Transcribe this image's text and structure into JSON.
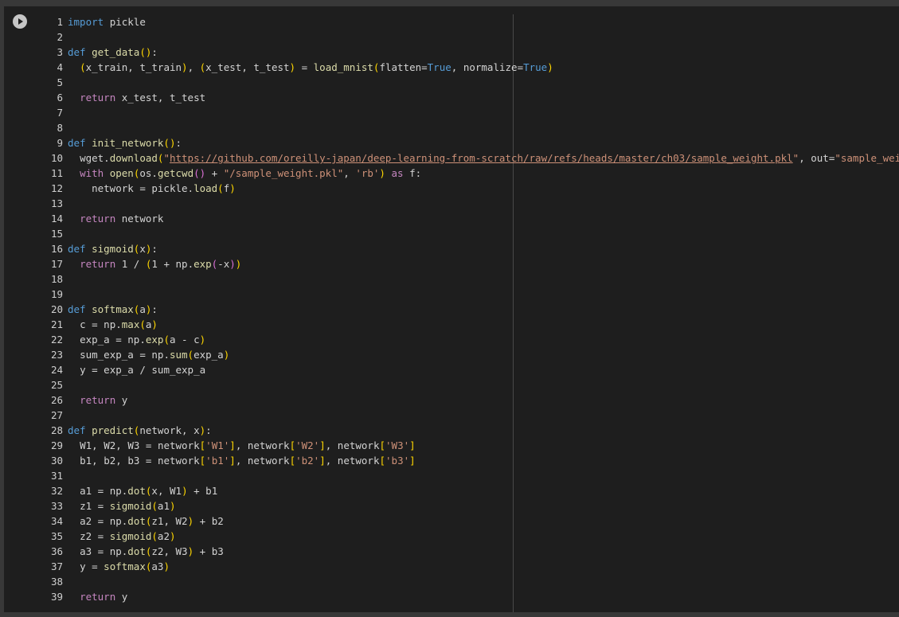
{
  "cell": {
    "run_button_icon": "play-circle-icon",
    "code_lines": [
      "import pickle",
      "",
      "def get_data():",
      "  (x_train, t_train), (x_test, t_test) = load_mnist(flatten=True, normalize=True)",
      "",
      "  return x_test, t_test",
      "",
      "",
      "def init_network():",
      "  wget.download(\"https://github.com/oreilly-japan/deep-learning-from-scratch/raw/refs/heads/master/ch03/sample_weight.pkl\", out=\"sample_weight.pkl\")",
      "  with open(os.getcwd() + \"/sample_weight.pkl\", 'rb') as f:",
      "    network = pickle.load(f)",
      "",
      "  return network",
      "",
      "def sigmoid(x):",
      "  return 1 / (1 + np.exp(-x))",
      "",
      "",
      "def softmax(a):",
      "  c = np.max(a)",
      "  exp_a = np.exp(a - c)",
      "  sum_exp_a = np.sum(exp_a)",
      "  y = exp_a / sum_exp_a",
      "",
      "  return y",
      "",
      "def predict(network, x):",
      "  W1, W2, W3 = network['W1'], network['W2'], network['W3']",
      "  b1, b2, b3 = network['b1'], network['b2'], network['b3']",
      "",
      "  a1 = np.dot(x, W1) + b1",
      "  z1 = sigmoid(a1)",
      "  a2 = np.dot(z1, W2) + b2",
      "  z2 = sigmoid(a2)",
      "  a3 = np.dot(z2, W3) + b3",
      "  y = softmax(a3)",
      "",
      "  return y"
    ]
  }
}
